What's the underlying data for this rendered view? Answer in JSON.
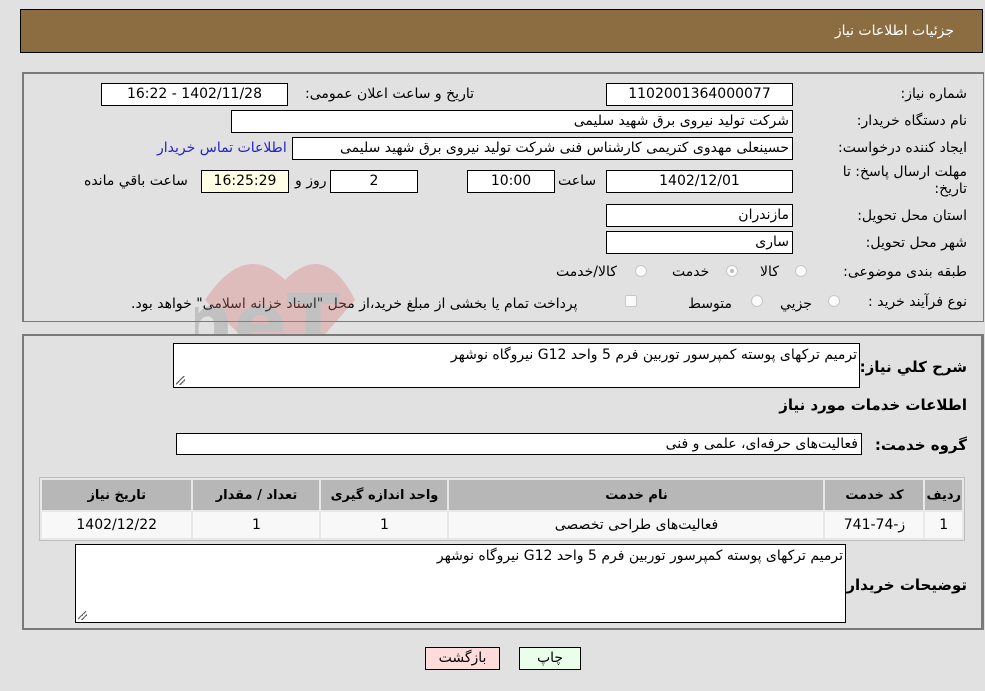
{
  "header": {
    "title": "جزئیات اطلاعات نیاز"
  },
  "form": {
    "need_number": {
      "label": "شماره نیاز:",
      "value": "1102001364000077"
    },
    "announce_datetime": {
      "label": "تاریخ و ساعت اعلان عمومی:",
      "value": "1402/11/28 - 16:22"
    },
    "buyer_org": {
      "label": "نام دستگاه خریدار:",
      "value": "شرکت تولید نیروی برق شهید سلیمی"
    },
    "requester": {
      "label": "ایجاد کننده درخواست:",
      "value": "حسینعلی مهدوی کتریمی کارشناس فنی شرکت تولید نیروی برق شهید سلیمی"
    },
    "buyer_contact_link": "اطلاعات تماس خریدار",
    "deadline": {
      "label": "مهلت ارسال پاسخ: تا تاریخ:",
      "date": "1402/12/01",
      "time_label": "ساعت",
      "time": "10:00",
      "days": "2",
      "days_label": "روز و",
      "remaining": "16:25:29",
      "remaining_label": "ساعت باقي مانده"
    },
    "province": {
      "label": "استان محل تحویل:",
      "value": "مازندران"
    },
    "city": {
      "label": "شهر محل تحویل:",
      "value": "ساری"
    },
    "category": {
      "label": "طبقه بندی موضوعی:",
      "options": [
        "کالا",
        "خدمت",
        "کالا/خدمت"
      ],
      "selected": "خدمت"
    },
    "purchase_type": {
      "label": "نوع فرآیند خرید :",
      "options": [
        "جزيي",
        "متوسط"
      ],
      "selected": "جزيي",
      "treasury_note": "پرداخت تمام یا بخشی از مبلغ خرید،از محل \"اسناد خزانه اسلامی\" خواهد بود."
    }
  },
  "details": {
    "description_label": "شرح کلي نياز:",
    "description": "ترمیم ترکهای پوسته کمپرسور توربین فرم 5 واحد G12 نیروگاه نوشهر",
    "services_title": "اطلاعات خدمات مورد نیاز",
    "service_group_label": "گروه خدمت:",
    "service_group": "فعالیت‌های حرفه‌ای، علمی و فنی",
    "table": {
      "headers": [
        "ردیف",
        "کد خدمت",
        "نام خدمت",
        "واحد اندازه گیری",
        "تعداد / مقدار",
        "تاریخ نیاز"
      ],
      "rows": [
        [
          "1",
          "ز-74-741",
          "فعالیت‌های طراحی تخصصی",
          "1",
          "1",
          "1402/12/22"
        ]
      ]
    },
    "buyer_notes_label": "توضیحات خریدار:",
    "buyer_notes": "ترمیم ترکهای پوسته کمپرسور توربین فرم 5 واحد G12 نیروگاه نوشهر"
  },
  "buttons": {
    "print": "چاپ",
    "back": "بازگشت"
  },
  "watermark": "AriaTender.neT",
  "colors": {
    "header_bg": "#8c6d42",
    "link": "#2323c8",
    "print_bg": "#eaffea",
    "back_bg": "#ffdcdc"
  }
}
